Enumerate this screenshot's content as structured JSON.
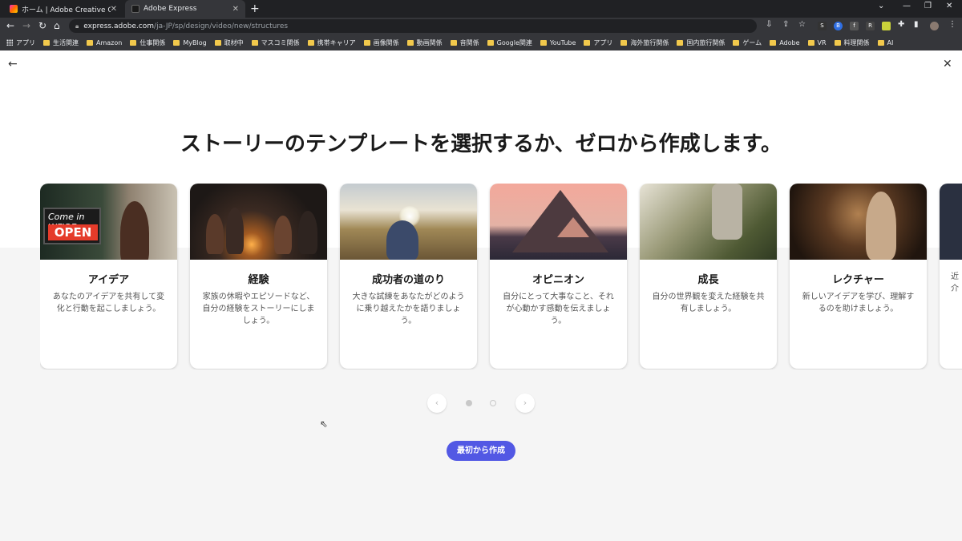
{
  "browser": {
    "tabs": [
      {
        "title": "ホーム | Adobe Creative Cloud",
        "active": false
      },
      {
        "title": "Adobe Express",
        "active": true
      }
    ],
    "address": {
      "host": "express.adobe.com",
      "path": "/ja-JP/sp/design/video/new/structures"
    },
    "bookmarks": [
      "アプリ",
      "生活関連",
      "Amazon",
      "仕事関係",
      "MyBlog",
      "取材中",
      "マスコミ関係",
      "携帯キャリア",
      "画像関係",
      "動画関係",
      "音関係",
      "Google関連",
      "YouTube",
      "アプリ",
      "海外旅行関係",
      "国内旅行関係",
      "ゲーム",
      "Adobe",
      "VR",
      "料理関係",
      "AI"
    ],
    "extensions": [
      "S",
      "B",
      "f",
      "R"
    ]
  },
  "page": {
    "heading": "ストーリーのテンプレートを選択するか、ゼロから作成します。",
    "sign_text": {
      "line1": "Come in WE'RE",
      "line2": "OPEN"
    },
    "cards": [
      {
        "title": "アイデア",
        "desc": "あなたのアイデアを共有して変化と行動を起こしましょう。"
      },
      {
        "title": "経験",
        "desc": "家族の休暇やエピソードなど、自分の経験をストーリーにしましょう。"
      },
      {
        "title": "成功者の道のり",
        "desc": "大きな試練をあなたがどのように乗り越えたかを語りましょう。"
      },
      {
        "title": "オピニオン",
        "desc": "自分にとって大事なこと、それが心動かす感動を伝えましょう。"
      },
      {
        "title": "成長",
        "desc": "自分の世界観を変えた経験を共有しましょう。"
      },
      {
        "title": "レクチャー",
        "desc": "新しいアイデアを学び、理解するのを助けましょう。"
      },
      {
        "title": "",
        "desc": "近 介"
      }
    ],
    "pager": {
      "current": 1,
      "total": 2
    },
    "create_button": "最初から作成"
  },
  "colors": {
    "accent": "#5258e4",
    "sign_red": "#e53b2a"
  }
}
